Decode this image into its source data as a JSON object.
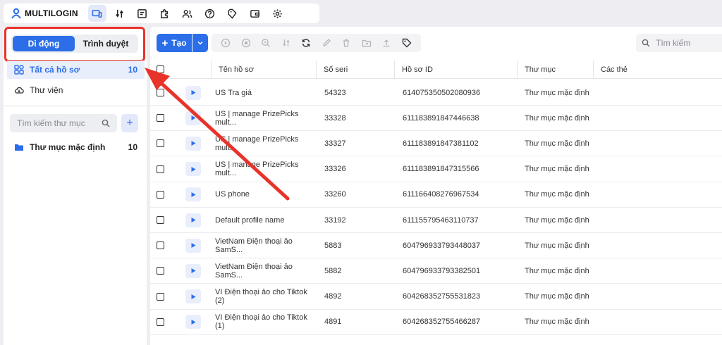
{
  "app": {
    "logo_text": "MULTILOGIN"
  },
  "top_nav": {
    "icons": [
      "devices-icon",
      "automation-icon",
      "profiles-icon",
      "extensions-icon",
      "team-icon",
      "help-icon",
      "billing-icon",
      "wallet-icon",
      "settings-icon"
    ]
  },
  "sidebar": {
    "segment": {
      "mobile": "Di động",
      "browser": "Trình duyệt"
    },
    "all_profiles": {
      "label": "Tất cả hồ sơ",
      "count": "10"
    },
    "library": {
      "label": "Thư viện"
    },
    "folder_search_placeholder": "Tìm kiếm thư mục",
    "add_label": "+",
    "default_folder": {
      "label": "Thư mục mặc định",
      "count": "10"
    }
  },
  "toolbar": {
    "create_label": "Tạo",
    "search_placeholder": "Tìm kiếm"
  },
  "table": {
    "headers": {
      "name": "Tên hồ sơ",
      "serial": "Số seri",
      "profile_id": "Hồ sơ ID",
      "folder": "Thư mục",
      "tags": "Các thẻ"
    },
    "rows": [
      {
        "name": "US Tra giá",
        "serial": "54323",
        "profile_id": "614075350502080936",
        "folder": "Thư mục mặc định"
      },
      {
        "name": "US | manage PrizePicks mult...",
        "serial": "33328",
        "profile_id": "611183891847446638",
        "folder": "Thư mục mặc định"
      },
      {
        "name": "US | manage PrizePicks mult...",
        "serial": "33327",
        "profile_id": "611183891847381102",
        "folder": "Thư mục mặc định"
      },
      {
        "name": "US | manage PrizePicks mult...",
        "serial": "33326",
        "profile_id": "611183891847315566",
        "folder": "Thư mục mặc định"
      },
      {
        "name": "US phone",
        "serial": "33260",
        "profile_id": "611166408276967534",
        "folder": "Thư mục mặc định"
      },
      {
        "name": "Default profile name",
        "serial": "33192",
        "profile_id": "611155795463110737",
        "folder": "Thư mục mặc định"
      },
      {
        "name": "VietNam Điện thoại ảo SamS...",
        "serial": "5883",
        "profile_id": "604796933793448037",
        "folder": "Thư mục mặc định"
      },
      {
        "name": "VietNam Điện thoại ảo SamS...",
        "serial": "5882",
        "profile_id": "604796933793382501",
        "folder": "Thư mục mặc định"
      },
      {
        "name": "VI Điện thoại ảo cho Tiktok (2)",
        "serial": "4892",
        "profile_id": "604268352755531823",
        "folder": "Thư mục mặc định"
      },
      {
        "name": "VI Điện thoại ảo cho Tiktok (1)",
        "serial": "4891",
        "profile_id": "604268352755466287",
        "folder": "Thư mục mặc định"
      }
    ]
  },
  "colors": {
    "accent": "#2b6ee8",
    "annotation": "#e8332a"
  }
}
